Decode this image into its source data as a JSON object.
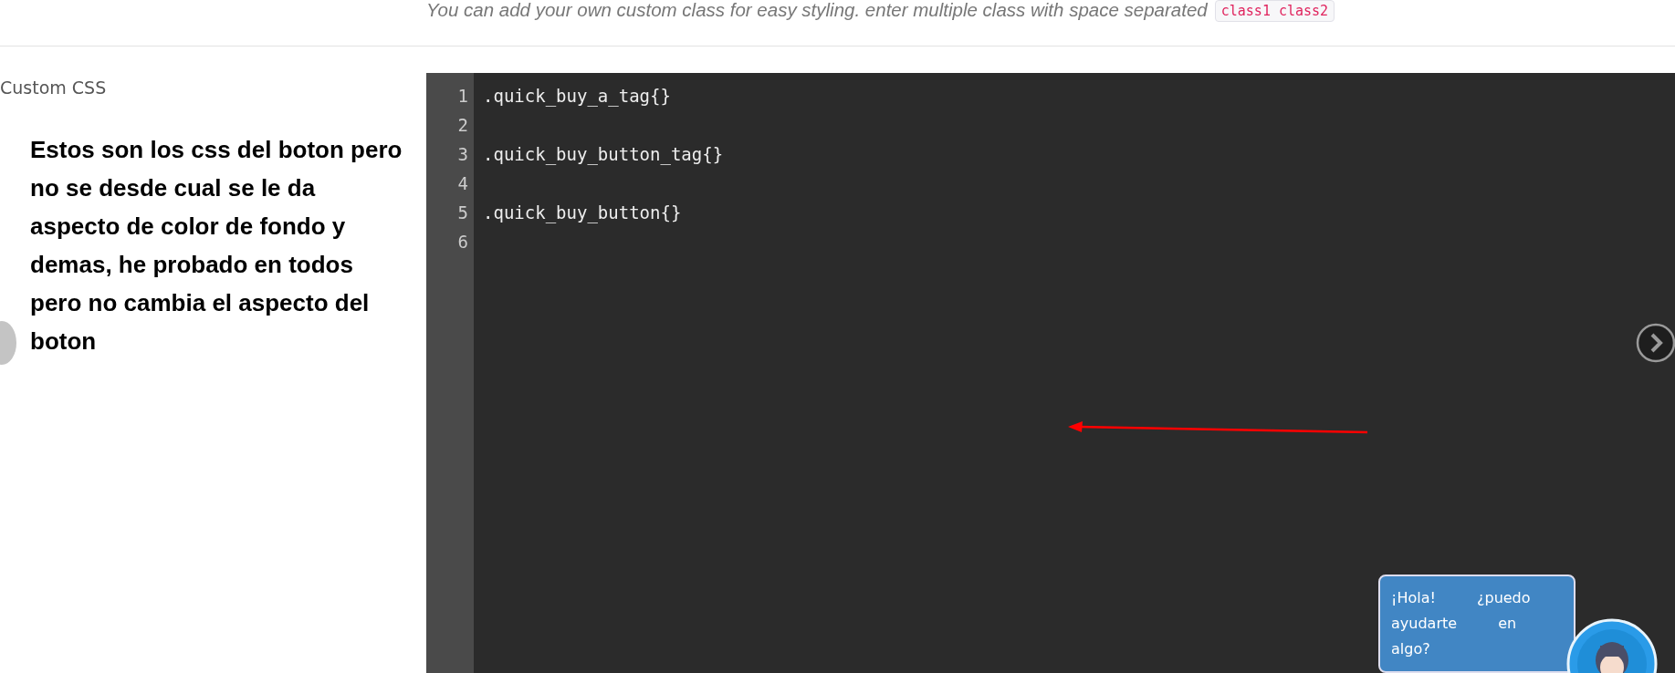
{
  "hint": {
    "text": "You can add your own custom class for easy styling. enter multiple class with space separated",
    "code": "class1 class2"
  },
  "field": {
    "label": "Custom CSS"
  },
  "annotation": "Estos son los css del boton pero no se desde cual se le da aspecto de color de fondo y demas, he probado en todos pero no cambia el aspecto del boton",
  "editor": {
    "lines": [
      {
        "number": "1",
        "code": ".quick_buy_a_tag{}"
      },
      {
        "number": "2"
      },
      {
        "number": "3",
        "code": ".quick_buy_button_tag{}"
      },
      {
        "number": "4"
      },
      {
        "number": "5",
        "code": ".quick_buy_button{}"
      },
      {
        "number": "6"
      }
    ]
  },
  "chat": {
    "message": "¡Hola! ¿puedo ayudarte en algo?"
  }
}
